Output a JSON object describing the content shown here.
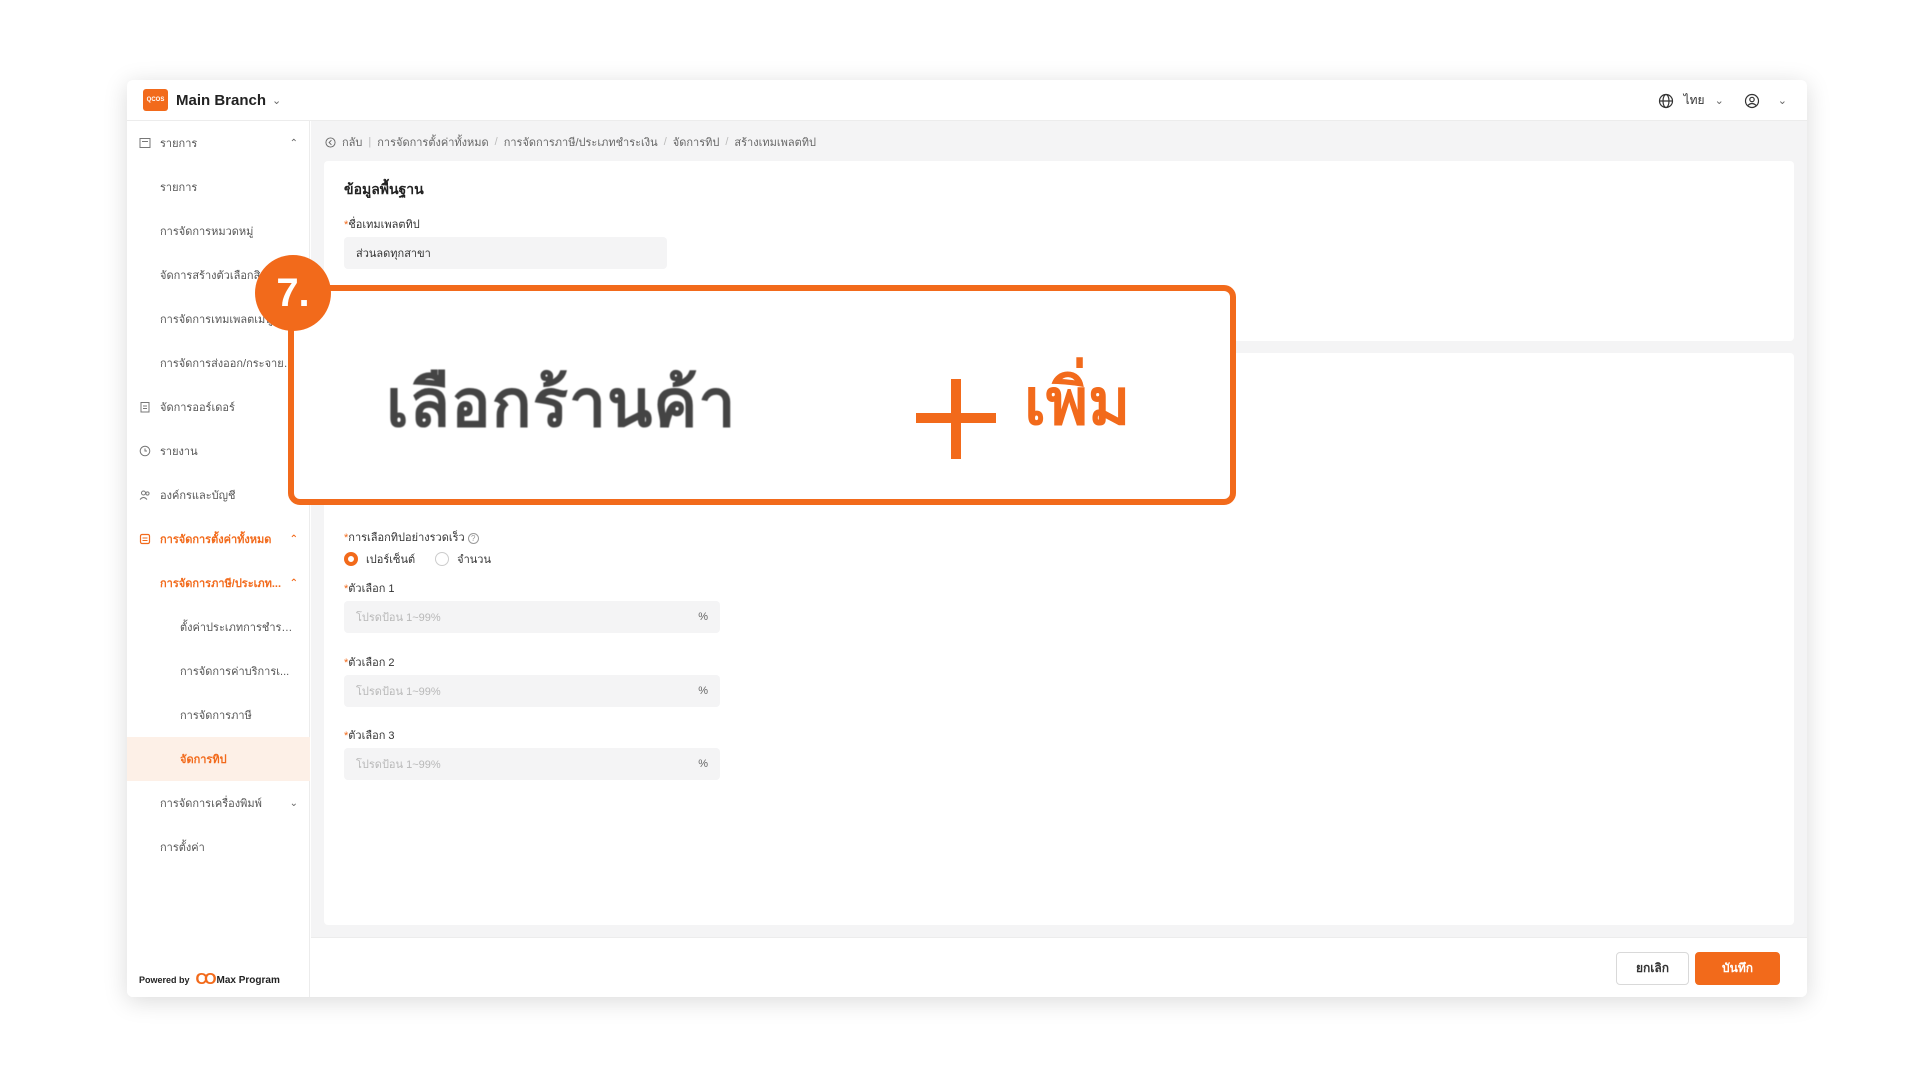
{
  "header": {
    "logo_text": "QCOS",
    "branch": "Main Branch",
    "language": "ไทย"
  },
  "sidebar": {
    "items": [
      {
        "label": "รายการ"
      },
      {
        "label": "รายการ"
      },
      {
        "label": "การจัดการหมวดหมู่"
      },
      {
        "label": "จัดการสร้างตัวเลือกสินค้า"
      },
      {
        "label": "การจัดการเทมเพลตเมนู"
      },
      {
        "label": "การจัดการส่งออก/กระจายเมนู"
      },
      {
        "label": "จัดการออร์เดอร์"
      },
      {
        "label": "รายงาน"
      },
      {
        "label": "องค์กรและบัญชี"
      },
      {
        "label": "การจัดการตั้งค่าทั้งหมด"
      },
      {
        "label": "การจัดการภาษี/ประเภท..."
      },
      {
        "label": "ตั้งค่าประเภทการชำระ..."
      },
      {
        "label": "การจัดการค่าบริการเ..."
      },
      {
        "label": "การจัดการภาษี"
      },
      {
        "label": "จัดการทิป"
      },
      {
        "label": "การจัดการเครื่องพิมพ์"
      },
      {
        "label": "การตั้งค่า"
      }
    ],
    "powered_by": "Powered by",
    "program": "Max Program"
  },
  "breadcrumb": {
    "back": "กลับ",
    "items": [
      "การจัดการตั้งค่าทั้งหมด",
      "การจัดการภาษี/ประเภทชำระเงิน",
      "จัดการทิป",
      "สร้างเทมเพลตทิป"
    ]
  },
  "form": {
    "section_title": "ข้อมูลพื้นฐาน",
    "template_name_label": "ชื่อเทมเพลตทิป",
    "template_name_value": "ส่วนลดทุกสาขา",
    "quick_tip_label": "การเลือกทิปอย่างรวดเร็ว",
    "radio_percent": "เปอร์เซ็นต์",
    "radio_amount": "จำนวน",
    "option1_label": "ตัวเลือก 1",
    "option2_label": "ตัวเลือก 2",
    "option3_label": "ตัวเลือก 3",
    "option_placeholder": "โปรดป้อน 1~99%",
    "unit": "%"
  },
  "footer": {
    "cancel": "ยกเลิก",
    "save": "บันทึก"
  },
  "callout": {
    "step": "7.",
    "select_store": "เลือกร้านค้า",
    "add": "เพิ่ม"
  },
  "colors": {
    "accent": "#f26a1b",
    "selected_bg": "#fdf0e7"
  }
}
